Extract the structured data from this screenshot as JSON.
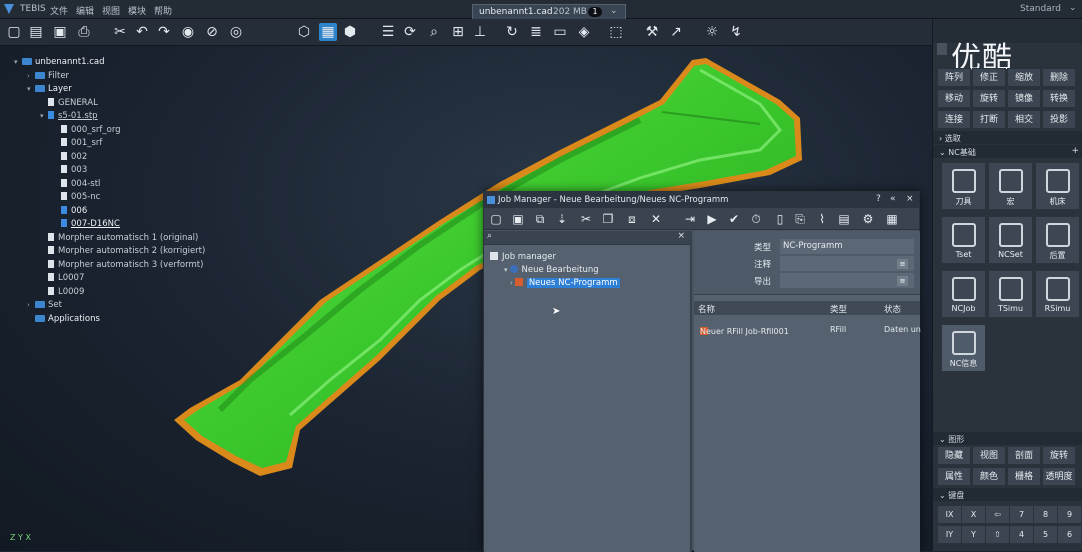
{
  "menubar": {
    "app": "TEBIS",
    "items": [
      "文件",
      "编辑",
      "视图",
      "模块",
      "帮助"
    ]
  },
  "doctab": {
    "filename": "unbenannt1.cad",
    "size": "202 MB",
    "badge": "1"
  },
  "mode": "Standard",
  "toolbar_icons": [
    "new-file",
    "open-file",
    "save",
    "print",
    "cut",
    "undo",
    "redo",
    "eye",
    "hide",
    "palette",
    "cube-front",
    "cube-selected",
    "cube",
    "layers",
    "rotate",
    "zoom",
    "fit",
    "axis",
    "refresh",
    "list",
    "window",
    "sections",
    "box",
    "hammer",
    "pick",
    "light",
    "navigate"
  ],
  "tree": [
    {
      "label": "unbenannt1.cad",
      "level": 0,
      "icon": "folder",
      "arrow": "down",
      "bold": true
    },
    {
      "label": "Filter",
      "level": 1,
      "icon": "folder",
      "arrow": "right"
    },
    {
      "label": "Layer",
      "level": 1,
      "icon": "folder",
      "arrow": "down",
      "bold": true
    },
    {
      "label": "GENERAL",
      "level": 2,
      "icon": "doc"
    },
    {
      "label": "s5-01.stp",
      "level": 2,
      "icon": "doc-blue",
      "arrow": "down",
      "underline": true
    },
    {
      "label": "000_srf_org",
      "level": 3,
      "icon": "doc"
    },
    {
      "label": "001_srf",
      "level": 3,
      "icon": "doc"
    },
    {
      "label": "002",
      "level": 3,
      "icon": "doc"
    },
    {
      "label": "003",
      "level": 3,
      "icon": "doc"
    },
    {
      "label": "004-stl",
      "level": 3,
      "icon": "doc"
    },
    {
      "label": "005-nc",
      "level": 3,
      "icon": "doc"
    },
    {
      "label": "006",
      "level": 3,
      "icon": "doc-blue",
      "bold": true
    },
    {
      "label": "007-D16NC",
      "level": 3,
      "icon": "doc-blue",
      "bold": true,
      "underline": true
    },
    {
      "label": "Morpher automatisch 1 (original)",
      "level": 2,
      "icon": "doc"
    },
    {
      "label": "Morpher automatisch 2 (korrigiert)",
      "level": 2,
      "icon": "doc"
    },
    {
      "label": "Morpher automatisch 3 (verformt)",
      "level": 2,
      "icon": "doc"
    },
    {
      "label": "L0007",
      "level": 2,
      "icon": "doc"
    },
    {
      "label": "L0009",
      "level": 2,
      "icon": "doc"
    },
    {
      "label": "Set",
      "level": 1,
      "icon": "folder",
      "arrow": "right"
    },
    {
      "label": "Applications",
      "level": 1,
      "icon": "folder",
      "bold": true
    }
  ],
  "axes_label": "Z Y X",
  "jobmanager": {
    "title": "Job Manager - Neue Bearbeitung/Neues NC-Programm",
    "title_buttons": [
      "?",
      "«",
      "×"
    ],
    "toolbar_icons": [
      "new",
      "save",
      "copy",
      "down",
      "scissors",
      "clone",
      "duplicate",
      "delete",
      "pin",
      "play",
      "check",
      "timer",
      "tool",
      "export",
      "nc",
      "table",
      "settings",
      "grid"
    ],
    "tree": [
      {
        "label": "Job manager",
        "icon": "folder"
      },
      {
        "label": "Neue Bearbeitung",
        "icon": "job"
      },
      {
        "label": "Neues NC-Programm",
        "icon": "nc",
        "selected": true
      }
    ],
    "props": [
      {
        "label": "类型",
        "value": "NC-Programm"
      },
      {
        "label": "注释",
        "value": ""
      },
      {
        "label": "导出",
        "value": ""
      }
    ],
    "grid_headers": [
      "名称",
      "类型",
      "状态"
    ],
    "grid_rows": [
      [
        "Neuer RFill Job-Rfil001",
        "RFill",
        "Daten un"
      ]
    ]
  },
  "rightpanel": {
    "watermark": "优酷",
    "top_buttons": [
      "阵列",
      "修正",
      "缩放",
      "删除",
      "移动",
      "旋转",
      "镜像",
      "转换",
      "连接",
      "打断",
      "相交",
      "投影"
    ],
    "section_select": "选取",
    "section_nc": "NC基础",
    "nc_buttons": [
      "刀具",
      "宏",
      "机床",
      "Tset",
      "NCSet",
      "后置",
      "NCJob",
      "TSimu",
      "RSimu",
      "NC信息"
    ],
    "section_graphics": "图形",
    "graphics_buttons": [
      "隐藏",
      "视图",
      "剖面",
      "旋转",
      "属性",
      "颜色",
      "栅格",
      "透明度"
    ],
    "section_keyboard": "键盘",
    "keys_row1": [
      "IX",
      "X",
      "⇦",
      "7",
      "8",
      "9"
    ],
    "keys_row2": [
      "IY",
      "Y",
      "⇧",
      "4",
      "5",
      "6"
    ]
  }
}
